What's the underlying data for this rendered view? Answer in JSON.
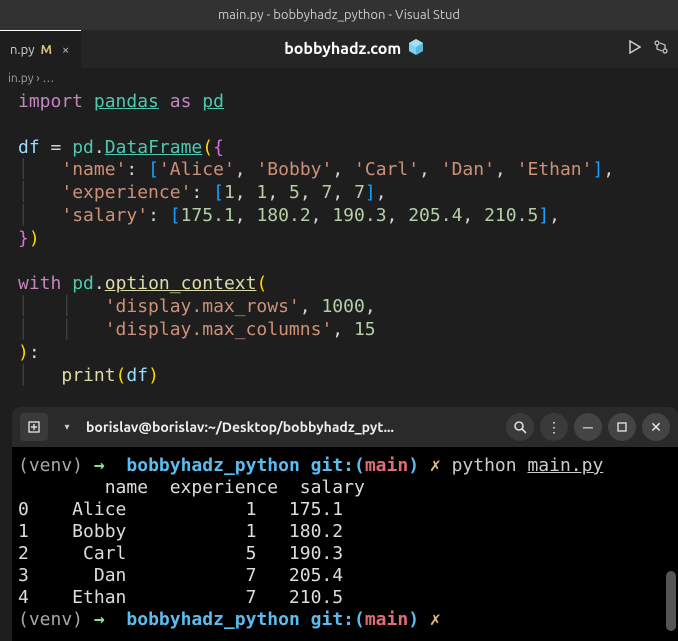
{
  "title_bar": "main.py - bobbyhadz_python - Visual Stud",
  "tab": {
    "name": "n.py",
    "modified": "M"
  },
  "site_label": "bobbyhadz.com",
  "breadcrumb": {
    "file": "in.py",
    "sep": "›",
    "more": "…"
  },
  "code": {
    "l1_import": "import",
    "l1_pandas": "pandas",
    "l1_as": "as",
    "l1_pd": "pd",
    "l3_df": "df",
    "l3_eq": " = ",
    "l3_pd": "pd",
    "l3_dot": ".",
    "l3_cls": "DataFrame",
    "l3_op": "(",
    "l3_br": "{",
    "l4_key": "'name'",
    "l4_v1": "'Alice'",
    "l4_v2": "'Bobby'",
    "l4_v3": "'Carl'",
    "l4_v4": "'Dan'",
    "l4_v5": "'Ethan'",
    "l5_key": "'experience'",
    "l5_v1": "1",
    "l5_v2": "1",
    "l5_v3": "5",
    "l5_v4": "7",
    "l5_v5": "7",
    "l6_key": "'salary'",
    "l6_v1": "175.1",
    "l6_v2": "180.2",
    "l6_v3": "190.3",
    "l6_v4": "205.4",
    "l6_v5": "210.5",
    "l7_br": "}",
    "l7_cp": ")",
    "l9_with": "with",
    "l9_pd": "pd",
    "l9_fn": "option_context",
    "l10_arg1": "'display.max_rows'",
    "l10_n1": "1000",
    "l11_arg2": "'display.max_columns'",
    "l11_n2": "15",
    "l13_print": "print",
    "l13_arg": "df"
  },
  "terminal": {
    "title": "borislav@borislav:~/Desktop/bobbyhadz_pyt...",
    "prompt1": {
      "venv": "(venv)",
      "arrow": "→",
      "dir": "bobbyhadz_python",
      "git": "git:(",
      "branch": "main",
      "gitclose": ")",
      "x": "✗",
      "cmd": "python",
      "file": "main.py"
    },
    "output_header": "        name  experience  salary",
    "rows": [
      "0    Alice           1   175.1",
      "1    Bobby           1   180.2",
      "2     Carl           5   190.3",
      "3      Dan           7   205.4",
      "4    Ethan           7   210.5"
    ],
    "prompt2": {
      "venv": "(venv)",
      "arrow": "→",
      "dir": "bobbyhadz_python",
      "git": "git:(",
      "branch": "main",
      "gitclose": ")",
      "x": "✗"
    }
  }
}
